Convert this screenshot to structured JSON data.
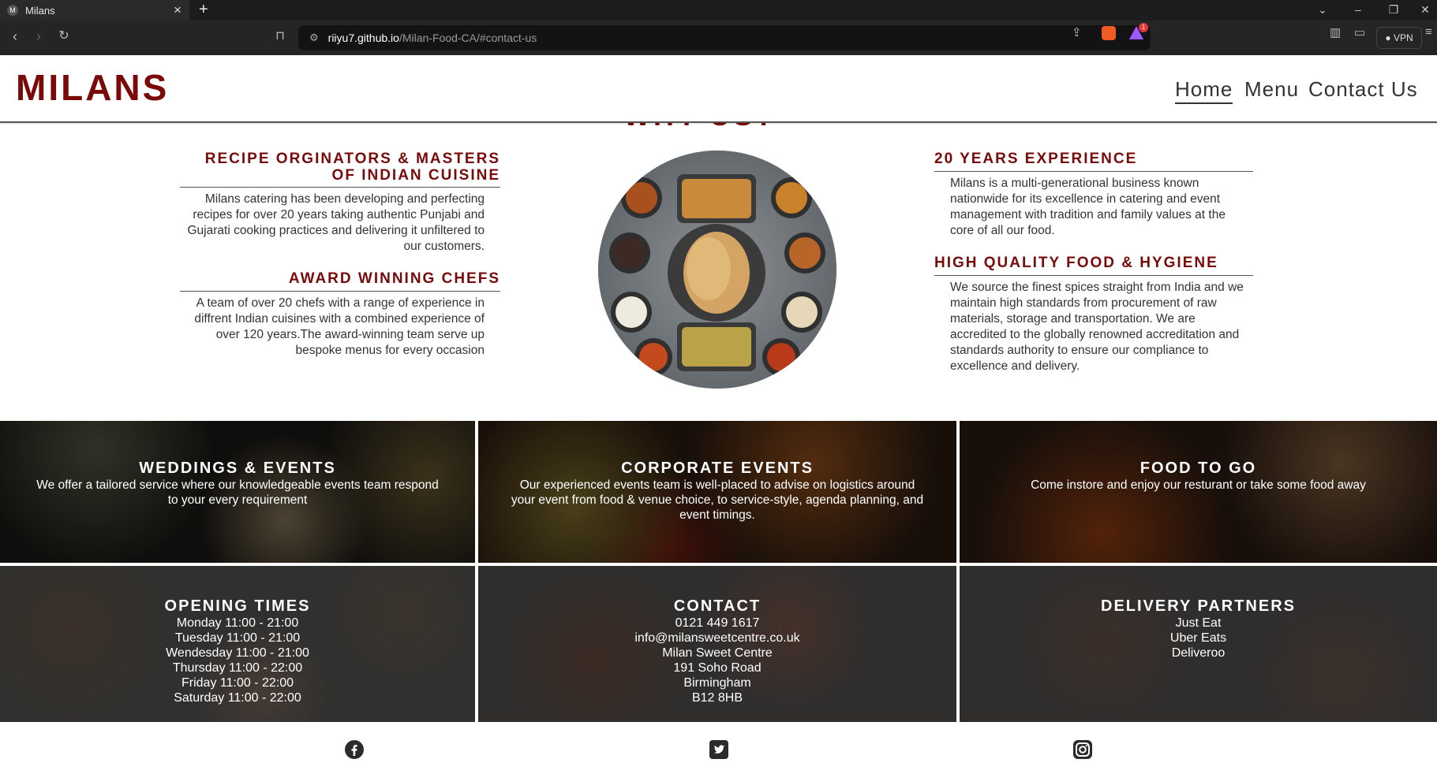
{
  "browser": {
    "tab_title": "Milans",
    "tab_favicon": "M",
    "url_host": "riiyu7.github.io",
    "url_path": "/Milan-Food-CA/#contact-us",
    "vpn_label": "VPN",
    "rewards_count": "1"
  },
  "header": {
    "logo": "MILANS",
    "nav": [
      "Home",
      "Menu",
      "Contact Us"
    ]
  },
  "about": {
    "left_features": [
      {
        "title": "RECIPE ORGINATORS & MASTERS OF INDIAN CUISINE",
        "text": "Milans catering has been developing and perfecting recipes for over 20 years taking authentic Punjabi and Gujarati cooking practices and delivering it unfiltered to our customers."
      },
      {
        "title": "AWARD WINNING CHEFS",
        "text": "A team of over 20 chefs with a range of experience in diffrent Indian cuisines with a combined experience of over 120 years.The award-winning team serve up bespoke menus for every occasion"
      }
    ],
    "right_features": [
      {
        "title": "20 YEARS EXPERIENCE",
        "text": "Milans is a multi-generational business known nationwide for its excellence in catering and event management with tradition and family values at the core of all our food."
      },
      {
        "title": "HIGH QUALITY FOOD & HYGIENE",
        "text": "We source the finest spices straight from India and we maintain high standards from procurement of raw materials, storage and transportation. We are accredited to the globally renowned accreditation and standards authority to ensure our compliance to excellence and delivery."
      }
    ]
  },
  "services": [
    {
      "title": "WEDDINGS & EVENTS",
      "text": "We offer a tailored service where our knowledgeable events team respond to your every requirement"
    },
    {
      "title": "CORPORATE EVENTS",
      "text": "Our experienced events team is well-placed to advise on logistics around your event from food & venue choice, to service-style, agenda planning, and event timings."
    },
    {
      "title": "FOOD TO GO",
      "text": "Come instore and enjoy our resturant or take some food away"
    }
  ],
  "info": [
    {
      "title": "OPENING TIMES",
      "lines": [
        "Monday 11:00 - 21:00",
        "Tuesday 11:00 - 21:00",
        "Wendesday 11:00 - 21:00",
        "Thursday 11:00 - 22:00",
        "Friday 11:00 - 22:00",
        "Saturday 11:00 - 22:00"
      ]
    },
    {
      "title": "CONTACT",
      "lines": [
        "0121 449 1617",
        "info@milansweetcentre.co.uk",
        "Milan Sweet Centre",
        "191 Soho Road",
        "Birmingham",
        "B12 8HB"
      ]
    },
    {
      "title": "DELIVERY PARTNERS",
      "lines": [
        "Just Eat",
        "Uber Eats",
        "Deliveroo"
      ]
    }
  ],
  "social": [
    "facebook-icon",
    "twitter-icon",
    "instagram-icon"
  ],
  "colors": {
    "brand": "#7a0a0a",
    "text": "#333333"
  }
}
